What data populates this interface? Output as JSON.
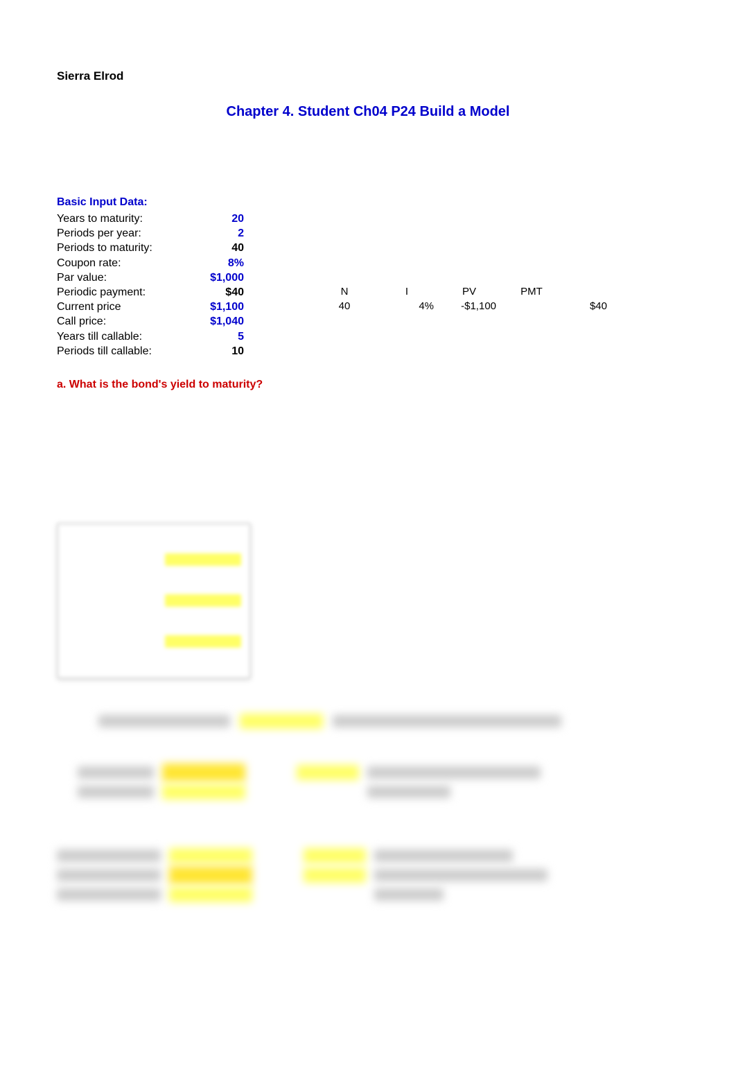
{
  "author": "Sierra Elrod",
  "chapter_title": "Chapter 4.  Student Ch04 P24 Build a Model",
  "section_heading": "Basic Input Data:",
  "inputs": {
    "years_to_maturity": {
      "label": "Years to maturity:",
      "value": "20",
      "color": "blue"
    },
    "periods_per_year": {
      "label": "Periods per year:",
      "value": "2",
      "color": "blue"
    },
    "periods_to_maturity": {
      "label": "Periods to maturity:",
      "value": "40",
      "color": "black"
    },
    "coupon_rate": {
      "label": "Coupon rate:",
      "value": "8%",
      "color": "blue"
    },
    "par_value": {
      "label": "Par value:",
      "value": "$1,000",
      "color": "blue"
    },
    "periodic_payment": {
      "label": "Periodic payment:",
      "value": "$40",
      "color": "black"
    },
    "current_price": {
      "label": "Current price",
      "value": "$1,100",
      "color": "blue"
    },
    "call_price": {
      "label": "Call price:",
      "value": "$1,040",
      "color": "blue"
    },
    "years_till_callable": {
      "label": "Years till callable:",
      "value": "5",
      "color": "blue"
    },
    "periods_till_callable": {
      "label": "Periods till callable:",
      "value": "10",
      "color": "black"
    }
  },
  "calc_headers": {
    "n": "N",
    "i": "I",
    "pv": "PV",
    "pmt": "PMT"
  },
  "calc_values": {
    "n": "40",
    "i": "4%",
    "pv": "-$1,100",
    "pmt": "$40"
  },
  "question_a": "a.   What is the bond's yield to maturity?"
}
